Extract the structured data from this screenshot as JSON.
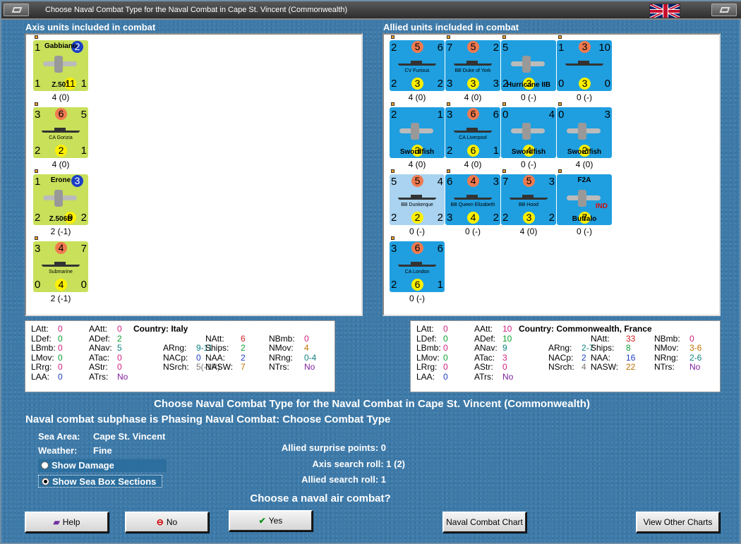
{
  "window": {
    "title": "Choose Naval Combat Type for the Naval Combat in Cape St. Vincent (Commonwealth)"
  },
  "axis": {
    "header": "Axis units included in combat",
    "units": [
      {
        "kind": "plane",
        "color": "green",
        "name": "Gabbiano",
        "sub": "Z.501",
        "tl": "1",
        "tc": "2",
        "tcColor": "#1b3fc4",
        "bl": "1",
        "br": "1",
        "bc": "11",
        "strength": "4 (0)"
      },
      {
        "kind": "ship",
        "color": "green",
        "name": "CA Gorizia",
        "tl": "3",
        "tc": "6",
        "tr": "5",
        "bl": "2",
        "bc": "2",
        "br": "1",
        "strength": "4 (0)"
      },
      {
        "kind": "plane",
        "color": "green",
        "name": "Erone",
        "sub": "Z.506B",
        "tl": "1",
        "tc": "3",
        "tcColor": "#1b3fc4",
        "bl": "2",
        "br": "2",
        "bc": "9",
        "strength": "2 (-1)"
      },
      {
        "kind": "ship",
        "color": "green",
        "name": "Submarine",
        "tl": "3",
        "tc": "4",
        "tr": "7",
        "bl": "0",
        "bc": "4",
        "br": "0",
        "strength": "2 (-1)"
      }
    ],
    "stats": {
      "LAtt": "0",
      "LDef": "0",
      "LBmb": "0",
      "LMov": "0",
      "LRrg": "0",
      "LAA": "0",
      "AAtt": "0",
      "ADef": "2",
      "ANav": "5",
      "ATac": "0",
      "AStr": "0",
      "ATrs": "No",
      "country": "Country: Italy",
      "ARng": "9-11",
      "NACp": "0",
      "NSrch": "5(-1R)",
      "NAtt": "6",
      "Ships": "2",
      "NAA": "2",
      "NASW": "7",
      "NBmb": "0",
      "NMov": "4",
      "NRng": "0-4",
      "NTrs": "No"
    }
  },
  "allied": {
    "header": "Allied units included in combat",
    "units": [
      {
        "kind": "ship",
        "color": "blue",
        "name": "CV Furious",
        "tl": "2",
        "tc": "5",
        "tr": "6",
        "bl": "2",
        "bc": "3",
        "br": "2",
        "strength": "4 (0)"
      },
      {
        "kind": "ship",
        "color": "blue",
        "name": "BB Duke of York",
        "tl": "7",
        "tc": "5",
        "tr": "2",
        "bl": "3",
        "bc": "3",
        "br": "3",
        "strength": "4 (0)"
      },
      {
        "kind": "plane",
        "color": "blue",
        "name": "Hurricane IIB",
        "sub": "",
        "tl": "5",
        "bl": "2",
        "bc": "3",
        "strength": "0 (-)"
      },
      {
        "kind": "ship",
        "color": "blue",
        "name": "",
        "tl": "1",
        "tc": "3",
        "tr": "10",
        "bl": "0",
        "bc": "3",
        "br": "0",
        "strength": "0 (-)"
      },
      {
        "kind": "plane",
        "color": "blue",
        "name": "Swordfish",
        "sub": "",
        "tl": "2",
        "tr": "1",
        "bc": "3",
        "strength": "4 (0)"
      },
      {
        "kind": "ship",
        "color": "blue",
        "name": "CA Liverpool",
        "tl": "3",
        "tc": "6",
        "tr": "6",
        "bl": "2",
        "bc": "6",
        "br": "1",
        "strength": "4 (0)"
      },
      {
        "kind": "plane",
        "color": "blue",
        "name": "Swordfish",
        "sub": "",
        "tl": "0",
        "tr": "4",
        "bc": "4",
        "strength": "0 (-)"
      },
      {
        "kind": "plane",
        "color": "blue",
        "name": "Swordfish",
        "sub": "",
        "tl": "0",
        "tr": "3",
        "bc": "2",
        "strength": "4 (0)"
      },
      {
        "kind": "ship",
        "color": "lblue",
        "name": "BB Dunkerque",
        "tl": "5",
        "tc": "5",
        "tr": "4",
        "bl": "2",
        "bc": "2",
        "br": "2",
        "strength": "0 (-)"
      },
      {
        "kind": "ship",
        "color": "blue",
        "name": "BB Queen Elizabeth",
        "tl": "6",
        "tc": "4",
        "tr": "3",
        "bl": "3",
        "bc": "4",
        "br": "2",
        "strength": "0 (-)"
      },
      {
        "kind": "ship",
        "color": "blue",
        "name": "BB Hood",
        "tl": "7",
        "tc": "5",
        "tr": "3",
        "bl": "2",
        "bc": "3",
        "br": "2",
        "strength": "4 (0)"
      },
      {
        "kind": "plane",
        "color": "blue",
        "name": "F2A",
        "sub": "Buffalo",
        "tag": "IND",
        "bc": "7",
        "strength": "0 (-)"
      },
      {
        "kind": "ship",
        "color": "blue",
        "name": "CA London",
        "tl": "3",
        "tc": "6",
        "tr": "6",
        "bl": "2",
        "bc": "6",
        "br": "1",
        "strength": "0 (-)"
      }
    ],
    "stats": {
      "LAtt": "0",
      "LDef": "0",
      "LBmb": "0",
      "LMov": "0",
      "LRrg": "0",
      "LAA": "0",
      "AAtt": "10",
      "ADef": "10",
      "ANav": "9",
      "ATac": "3",
      "AStr": "0",
      "ATrs": "No",
      "country": "Country: Commonwealth, France",
      "ARng": "2-7",
      "NACp": "2",
      "NSrch": "4",
      "NAtt": "33",
      "Ships": "8",
      "NAA": "16",
      "NASW": "22",
      "NBmb": "0",
      "NMov": "3-6",
      "NRng": "2-6",
      "NTrs": "No"
    }
  },
  "message": {
    "title": "Choose Naval Combat Type for the Naval Combat in Cape St. Vincent (Commonwealth)",
    "subphase": "Naval combat subphase is Phasing Naval Combat: Choose Combat Type",
    "sea_area_label": "Sea Area:",
    "sea_area": "Cape St. Vincent",
    "weather_label": "Weather:",
    "weather": "Fine",
    "surprise": "Allied surprise points:  0",
    "axis_roll": "Axis search roll:  1 (2)",
    "allied_roll": "Allied search roll:  1",
    "question": "Choose a naval air combat?"
  },
  "options": {
    "show_damage": "Show Damage",
    "show_sections": "Show Sea Box Sections"
  },
  "buttons": {
    "help": "Help",
    "no": "No",
    "yes": "Yes",
    "chart": "Naval Combat Chart",
    "other": "View Other Charts"
  },
  "colors": {
    "axis_unit": "#c8e05a",
    "allied_unit": "#1f9fe0",
    "window_bg": "#3d7aa9"
  }
}
